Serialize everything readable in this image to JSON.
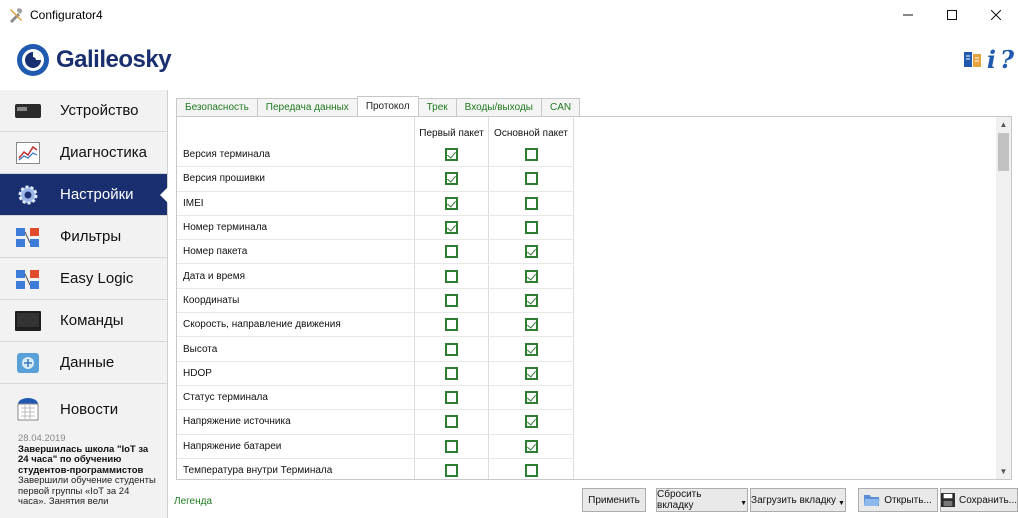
{
  "window": {
    "title": "Configurator4",
    "controls": {
      "minimize": "—",
      "maximize": "☐",
      "close": "✕"
    }
  },
  "header": {
    "logo_text": "Galileosky",
    "icons": [
      "dictionary-icon",
      "info-icon",
      "help-icon"
    ],
    "info_glyph": "i",
    "help_glyph": "?"
  },
  "sidebar": {
    "items": [
      {
        "label": "Устройство",
        "icon": "device-icon",
        "active": false
      },
      {
        "label": "Диагностика",
        "icon": "diagnostics-chart-icon",
        "active": false
      },
      {
        "label": "Настройки",
        "icon": "gear-icon",
        "active": true
      },
      {
        "label": "Фильтры",
        "icon": "filters-icon",
        "active": false
      },
      {
        "label": "Easy Logic",
        "icon": "easy-logic-icon",
        "active": false
      },
      {
        "label": "Команды",
        "icon": "commands-terminal-icon",
        "active": false
      },
      {
        "label": "Данные",
        "icon": "data-icon",
        "active": false
      }
    ],
    "news": {
      "label": "Новости",
      "icon": "calendar-icon",
      "date": "28.04.2019",
      "headline": "Завершилась школа \"IoT за 24 часа\" по обучению студентов-программистов",
      "text": "Завершили обучение студенты первой группы «IoT за 24 часа». Занятия вели"
    }
  },
  "tabs": [
    {
      "label": "Безопасность",
      "active": false
    },
    {
      "label": "Передача данных",
      "active": false
    },
    {
      "label": "Протокол",
      "active": true
    },
    {
      "label": "Трек",
      "active": false
    },
    {
      "label": "Входы/выходы",
      "active": false
    },
    {
      "label": "CAN",
      "active": false
    }
  ],
  "protocol_table": {
    "columns": {
      "first_packet": "Первый пакет",
      "main_packet": "Основной пакет"
    },
    "rows": [
      {
        "name": "Версия терминала",
        "first": true,
        "main": false
      },
      {
        "name": "Версия прошивки",
        "first": true,
        "main": false
      },
      {
        "name": "IMEI",
        "first": true,
        "main": false
      },
      {
        "name": "Номер терминала",
        "first": true,
        "main": false
      },
      {
        "name": "Номер пакета",
        "first": false,
        "main": true
      },
      {
        "name": "Дата и время",
        "first": false,
        "main": true
      },
      {
        "name": "Координаты",
        "first": false,
        "main": true
      },
      {
        "name": "Скорость, направление движения",
        "first": false,
        "main": true
      },
      {
        "name": "Высота",
        "first": false,
        "main": true
      },
      {
        "name": "HDOP",
        "first": false,
        "main": true
      },
      {
        "name": "Статус терминала",
        "first": false,
        "main": true
      },
      {
        "name": "Напряжение источника",
        "first": false,
        "main": true
      },
      {
        "name": "Напряжение батареи",
        "first": false,
        "main": true
      },
      {
        "name": "Температура внутри Терминала",
        "first": false,
        "main": false
      }
    ]
  },
  "footer": {
    "legend": "Легенда",
    "apply": "Применить",
    "reset_tab": "Сбросить вкладку",
    "load_tab": "Загрузить вкладку",
    "open": "Открыть...",
    "save": "Сохранить..."
  },
  "colors": {
    "brand_navy": "#1a2f6f",
    "checkbox_green": "#2e7d32",
    "tab_text_green": "#1f7a1f"
  }
}
